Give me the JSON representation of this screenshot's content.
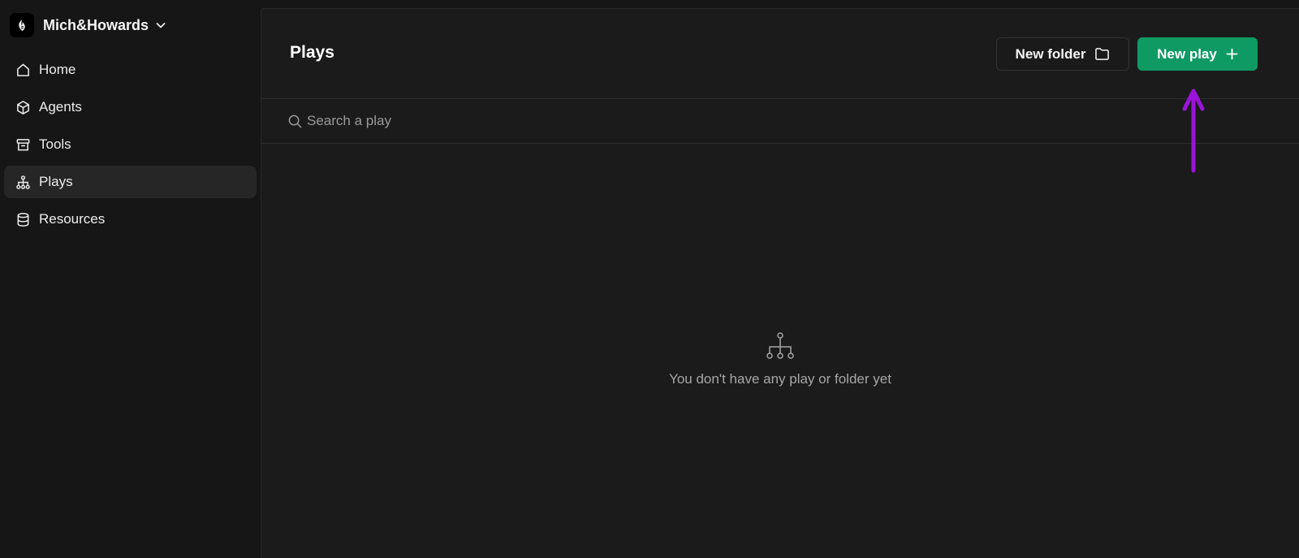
{
  "workspace": {
    "name": "Mich&Howards",
    "logo_icon": "flame-logo-icon",
    "chevron_icon": "chevron-down-icon"
  },
  "sidebar": {
    "items": [
      {
        "label": "Home",
        "icon": "home-icon",
        "active": false
      },
      {
        "label": "Agents",
        "icon": "cube-icon",
        "active": false
      },
      {
        "label": "Tools",
        "icon": "archive-box-icon",
        "active": false
      },
      {
        "label": "Plays",
        "icon": "sitemap-icon",
        "active": true
      },
      {
        "label": "Resources",
        "icon": "database-icon",
        "active": false
      }
    ]
  },
  "header": {
    "title": "Plays",
    "new_folder_label": "New folder",
    "new_play_label": "New play"
  },
  "search": {
    "placeholder": "Search a play",
    "value": ""
  },
  "empty_state": {
    "icon": "sitemap-icon",
    "message": "You don't have any play or folder yet"
  },
  "colors": {
    "background": "#161616",
    "panel": "#1b1b1b",
    "accent_green": "#0f9a64",
    "annotation_purple": "#9b13d9",
    "active_nav": "#262626"
  }
}
